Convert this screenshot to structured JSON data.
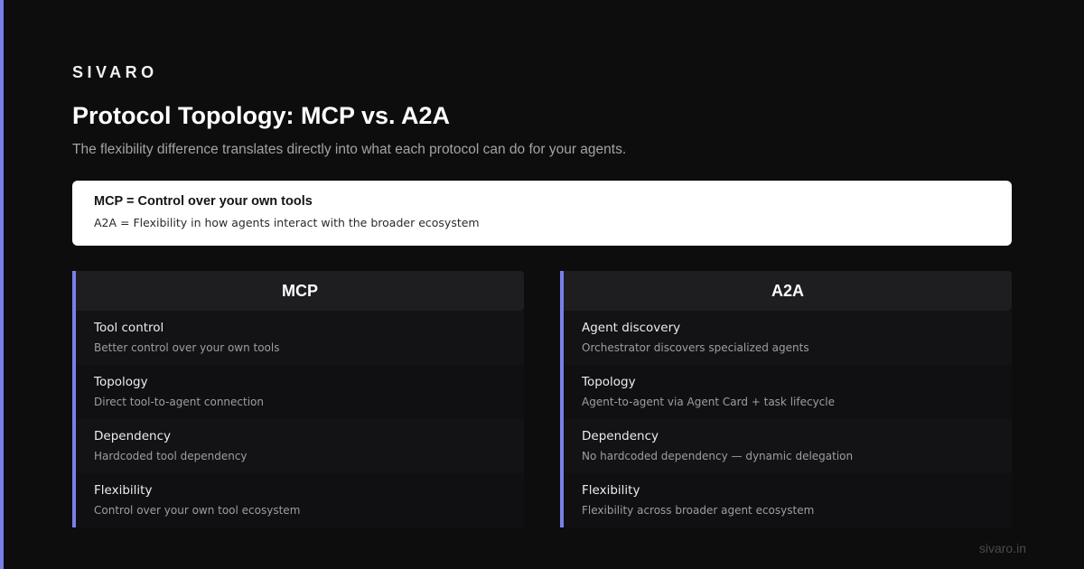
{
  "brand": "SIVARO",
  "title": "Protocol Topology: MCP vs. A2A",
  "subtitle": "The flexibility difference translates directly into what each protocol can do for your agents.",
  "callout": {
    "main": "MCP = Control over your own tools",
    "sub": "A2A = Flexibility in how agents interact with the broader ecosystem"
  },
  "columns": [
    {
      "heading": "MCP",
      "rows": [
        {
          "label": "Tool control",
          "desc": "Better control over your own tools"
        },
        {
          "label": "Topology",
          "desc": "Direct tool-to-agent connection"
        },
        {
          "label": "Dependency",
          "desc": "Hardcoded tool dependency"
        },
        {
          "label": "Flexibility",
          "desc": "Control over your own tool ecosystem"
        }
      ]
    },
    {
      "heading": "A2A",
      "rows": [
        {
          "label": "Agent discovery",
          "desc": "Orchestrator discovers specialized agents"
        },
        {
          "label": "Topology",
          "desc": "Agent-to-agent via Agent Card + task lifecycle"
        },
        {
          "label": "Dependency",
          "desc": "No hardcoded dependency — dynamic delegation"
        },
        {
          "label": "Flexibility",
          "desc": "Flexibility across broader agent ecosystem"
        }
      ]
    }
  ],
  "footer": "sivaro.in",
  "colors": {
    "accent": "#7b7fe8",
    "background": "#0d0d0d",
    "callout_background": "#ffffff"
  }
}
